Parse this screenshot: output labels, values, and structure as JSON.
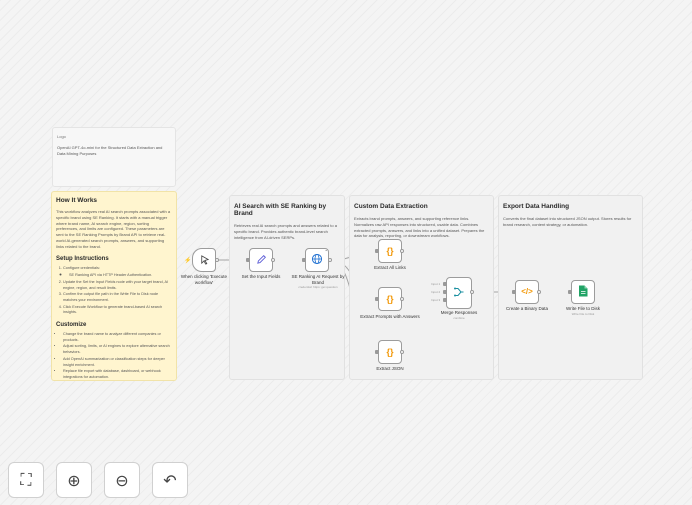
{
  "notes": {
    "logo_alt": "Logo",
    "logo_caption": "OpenAI GPT-4o-mini for the Structured Data Extraction and Data Mining Purposes",
    "how_title": "How It Works",
    "how_body": "This workflow analyzes real AI search prompts associated with a specific brand using SE Ranking. It starts with a manual trigger where brand name, AI search engine, region, sorting preferences, and limits are configured. These parameters are sent to the SE Ranking Prompts by Brand API to retrieve real-world AI-generated search prompts, answers, and supporting links related to the brand.",
    "setup_title": "Setup Instructions",
    "setup_steps": [
      "Configure credentials:",
      "Update the Set the Input Fields node with your target brand, AI engine, region, and result limits.",
      "Confirm the output file path in the Write File to Disk node matches your environment.",
      "Click Execute Workflow to generate brand-based AI search insights."
    ],
    "setup_sub": "SE Ranking API via HTTP Header Authentication.",
    "customize_title": "Customize",
    "customize_items": [
      "Change the brand name to analyze different companies or products.",
      "Adjust sorting, limits, or AI engines to explore alternative search behaviors.",
      "Add OpenAI summarization or classification steps for deeper insight enrichment.",
      "Replace file export with database, dashboard, or webhook integrations for automation."
    ]
  },
  "sections": [
    {
      "title": "AI Search with SE Ranking by Brand",
      "desc": "Retrieves real AI search prompts and answers related to a specific brand. Provides authentic brand-level search intelligence from AI-driven SERPs."
    },
    {
      "title": "Custom Data Extraction",
      "desc": "Extracts brand prompts, answers, and supporting reference links. Normalizes raw API responses into structured, usable data. Combines extracted prompts, answers, and links into a unified dataset. Prepares the data for analysis, reporting, or downstream workflows."
    },
    {
      "title": "Export Data Handling",
      "desc": "Converts the final dataset into structured JSON output. Stores results for brand research, content strategy, or automation."
    }
  ],
  "nodes": {
    "trigger": {
      "label": "When clicking 'Execute workflow'",
      "icon": "cursor-click-icon"
    },
    "set_fields": {
      "label": "Set the Input Fields",
      "icon": "pencil-icon"
    },
    "se_ranking": {
      "label": "SE Ranking AI Request by Brand",
      "sub": "credential: https: get question",
      "icon": "globe-icon"
    },
    "extract_links": {
      "label": "Extract All Links",
      "icon": "code-braces-icon"
    },
    "extract_prompts": {
      "label": "Extract Prompts with Answers",
      "icon": "code-braces-icon"
    },
    "extract_json": {
      "label": "Extract JSON",
      "icon": "code-braces-icon"
    },
    "merge": {
      "label": "Merge Responses",
      "sub": "combine",
      "icon": "merge-icon",
      "inputs": [
        "Input 1",
        "Input 2",
        "Input 3"
      ]
    },
    "binary": {
      "label": "Create a Binary Data",
      "icon": "code-brackets-icon"
    },
    "write_file": {
      "label": "Write File to Disk",
      "sub": "Write File to Disk",
      "icon": "file-icon"
    }
  },
  "colors": {
    "code_orange": "#f29705",
    "file_green": "#21a366",
    "trigger_red": "#ff6d5a",
    "sticky_yellow": "#fff5cf"
  },
  "controls": [
    {
      "name": "fit-to-view-button",
      "icon": "fit-view-icon",
      "glyph": "⛶"
    },
    {
      "name": "zoom-in-button",
      "icon": "zoom-in-icon",
      "glyph": "⊕"
    },
    {
      "name": "zoom-out-button",
      "icon": "zoom-out-icon",
      "glyph": "⊖"
    },
    {
      "name": "undo-button",
      "icon": "undo-icon",
      "glyph": "↶"
    }
  ]
}
